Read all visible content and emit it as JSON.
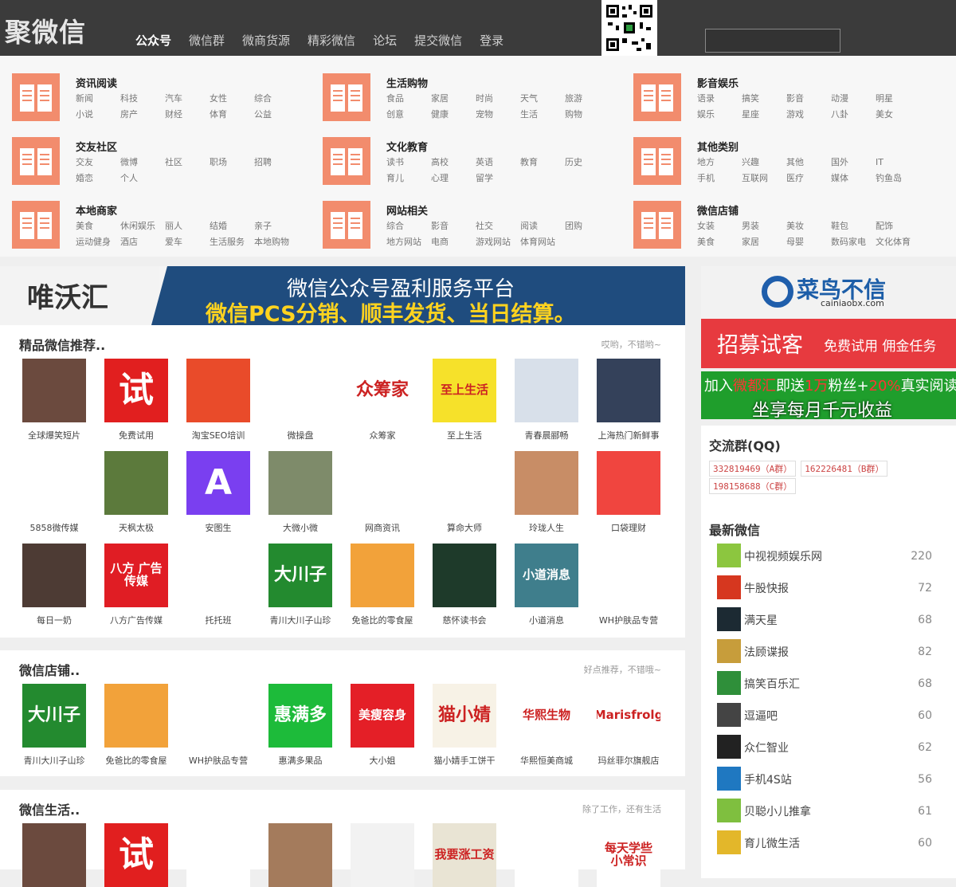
{
  "site": {
    "logo": "聚微信"
  },
  "nav": [
    "公众号",
    "微信群",
    "微商货源",
    "精彩微信",
    "论坛",
    "提交微信",
    "登录"
  ],
  "search": {
    "placeholder": ""
  },
  "categories": [
    {
      "title": "资讯阅读",
      "links": [
        "新闻",
        "科技",
        "汽车",
        "女性",
        "综合",
        "小说",
        "房产",
        "财经",
        "体育",
        "公益"
      ]
    },
    {
      "title": "生活购物",
      "links": [
        "食品",
        "家居",
        "时尚",
        "天气",
        "旅游",
        "创意",
        "健康",
        "宠物",
        "生活",
        "购物"
      ]
    },
    {
      "title": "影音娱乐",
      "links": [
        "语录",
        "搞笑",
        "影音",
        "动漫",
        "明星",
        "娱乐",
        "星座",
        "游戏",
        "八卦",
        "美女"
      ]
    },
    {
      "title": "交友社区",
      "links": [
        "交友",
        "微博",
        "社区",
        "职场",
        "招聘",
        "婚恋",
        "个人"
      ]
    },
    {
      "title": "文化教育",
      "links": [
        "读书",
        "高校",
        "英语",
        "教育",
        "历史",
        "育儿",
        "心理",
        "留学"
      ]
    },
    {
      "title": "其他类别",
      "links": [
        "地方",
        "兴趣",
        "其他",
        "国外",
        "IT",
        "手机",
        "互联网",
        "医疗",
        "媒体",
        "钓鱼岛"
      ]
    },
    {
      "title": "本地商家",
      "links": [
        "美食",
        "休闲娱乐",
        "丽人",
        "结婚",
        "亲子",
        "运动健身",
        "酒店",
        "爱车",
        "生活服务",
        "本地购物"
      ]
    },
    {
      "title": "网站相关",
      "links": [
        "综合",
        "影音",
        "社交",
        "阅读",
        "团购",
        "地方网站",
        "电商",
        "游戏网站",
        "体育网站"
      ]
    },
    {
      "title": "微信店铺",
      "links": [
        "女装",
        "男装",
        "美妆",
        "鞋包",
        "配饰",
        "美食",
        "家居",
        "母婴",
        "数码家电",
        "文化体育"
      ]
    }
  ],
  "banner": {
    "brand": "唯沃汇",
    "line1": "微信公众号盈利服务平台",
    "line2": "微信PCS分销、顺丰发货、当日结算。"
  },
  "sections": [
    {
      "title": "精品微信推荐..",
      "note": "哎哟，不错哟~",
      "items": [
        {
          "name": "全球爆笑短片",
          "thumb": "",
          "color": "#6b4a3e"
        },
        {
          "name": "免费试用",
          "thumb": "试",
          "color": "#e11f1f"
        },
        {
          "name": "淘宝SEO培训",
          "thumb": "",
          "color": "#e94b2a"
        },
        {
          "name": "微操盘",
          "thumb": "",
          "color": "#ffffff"
        },
        {
          "name": "众筹家",
          "thumb": "众筹家",
          "color": "#ffffff"
        },
        {
          "name": "至上生活",
          "thumb": "至上生活",
          "color": "#f6e12a"
        },
        {
          "name": "青春晨郦畅",
          "thumb": "",
          "color": "#d8e0ea"
        },
        {
          "name": "上海热门新鲜事",
          "thumb": "",
          "color": "#34415a"
        },
        {
          "name": "5858微传媒",
          "thumb": "",
          "color": "#ffffff"
        },
        {
          "name": "天枫太极",
          "thumb": "",
          "color": "#5c7a3c"
        },
        {
          "name": "安图生",
          "thumb": "A",
          "color": "#7a3ff0"
        },
        {
          "name": "大微小微",
          "thumb": "",
          "color": "#7e8b6a"
        },
        {
          "name": "网商资讯",
          "thumb": "",
          "color": "#ffffff"
        },
        {
          "name": "算命大师",
          "thumb": "",
          "color": "#ffffff"
        },
        {
          "name": "玲珑人生",
          "thumb": "",
          "color": "#c88d66"
        },
        {
          "name": "口袋理财",
          "thumb": "",
          "color": "#f0453f"
        },
        {
          "name": "每日一奶",
          "thumb": "",
          "color": "#4d3b34"
        },
        {
          "name": "八方广告传媒",
          "thumb": "八方 广告传媒",
          "color": "#e01d24"
        },
        {
          "name": "托托班",
          "thumb": "",
          "color": "#ffffff"
        },
        {
          "name": "青川大川子山珍",
          "thumb": "大川子",
          "color": "#238a2f"
        },
        {
          "name": "免爸比的零食屋",
          "thumb": "",
          "color": "#f2a23a"
        },
        {
          "name": "慈怀读书会",
          "thumb": "",
          "color": "#1e3a2a"
        },
        {
          "name": "小道消息",
          "thumb": "小道消息",
          "color": "#3f7e8c"
        },
        {
          "name": "WH护肤品专营",
          "thumb": "",
          "color": "#ffffff"
        }
      ]
    },
    {
      "title": "微信店铺..",
      "note": "好点推荐，不错哦~",
      "items": [
        {
          "name": "青川大川子山珍",
          "thumb": "大川子",
          "color": "#238a2f"
        },
        {
          "name": "免爸比的零食屋",
          "thumb": "",
          "color": "#f2a23a"
        },
        {
          "name": "WH护肤品专营",
          "thumb": "",
          "color": "#ffffff"
        },
        {
          "name": "惠满多果品",
          "thumb": "惠满多",
          "color": "#1dbb3a"
        },
        {
          "name": "大小姐",
          "thumb": "美瘦容身",
          "color": "#e41f27"
        },
        {
          "name": "猫小婧手工饼干",
          "thumb": "猫小婧",
          "color": "#f7f2e6"
        },
        {
          "name": "华熙恒美商城",
          "thumb": "华熙生物",
          "color": "#ffffff"
        },
        {
          "name": "玛丝菲尔旗舰店",
          "thumb": "Marisfrolg",
          "color": "#ffffff"
        }
      ]
    },
    {
      "title": "微信生活..",
      "note": "除了工作，还有生活",
      "items": [
        {
          "name": "",
          "thumb": "",
          "color": "#6b4a3e"
        },
        {
          "name": "",
          "thumb": "试",
          "color": "#e11f1f"
        },
        {
          "name": "",
          "thumb": "",
          "color": "#ffffff"
        },
        {
          "name": "",
          "thumb": "",
          "color": "#a47b5c"
        },
        {
          "name": "",
          "thumb": "",
          "color": "#f2f2f2"
        },
        {
          "name": "",
          "thumb": "我要涨工资",
          "color": "#e9e4d4"
        },
        {
          "name": "",
          "thumb": "",
          "color": "#ffffff"
        },
        {
          "name": "",
          "thumb": "每天学些 小常识",
          "color": "#ffffff"
        }
      ]
    }
  ],
  "right": {
    "ad1": {
      "title": "菜鸟不信",
      "sub": "cainiaobx.com"
    },
    "ad2": {
      "big": "招募试客",
      "small": "免费试用 佣金任务"
    },
    "ad3": {
      "line1_a": "加入",
      "line1_b": "微都汇",
      "line1_c": "即送",
      "line1_d": "1万",
      "line1_e": "粉丝+",
      "line1_f": "20%",
      "line1_g": "真实阅读量",
      "line2": "坐享每月千元收益"
    },
    "qq": {
      "title": "交流群(QQ)",
      "groups": [
        "332819469（A群）",
        "162226481（B群）",
        "198158688（C群）"
      ]
    },
    "latest": {
      "title": "最新微信",
      "items": [
        {
          "name": "中视视频娱乐网",
          "count": "220",
          "color": "#8cc63f"
        },
        {
          "name": "牛股快报",
          "count": "72",
          "color": "#d6371f"
        },
        {
          "name": "满天星",
          "count": "68",
          "color": "#1c2a33"
        },
        {
          "name": "法顾谍报",
          "count": "82",
          "color": "#c79d3b"
        },
        {
          "name": "搞笑百乐汇",
          "count": "68",
          "color": "#2f8f3a"
        },
        {
          "name": "逗逼吧",
          "count": "60",
          "color": "#444444"
        },
        {
          "name": "众仁智业",
          "count": "62",
          "color": "#222222"
        },
        {
          "name": "手机4S站",
          "count": "56",
          "color": "#1f78c1"
        },
        {
          "name": "贝聪小儿推拿",
          "count": "61",
          "color": "#7fbf3f"
        },
        {
          "name": "育儿微生活",
          "count": "60",
          "color": "#e3b72a"
        }
      ]
    }
  }
}
